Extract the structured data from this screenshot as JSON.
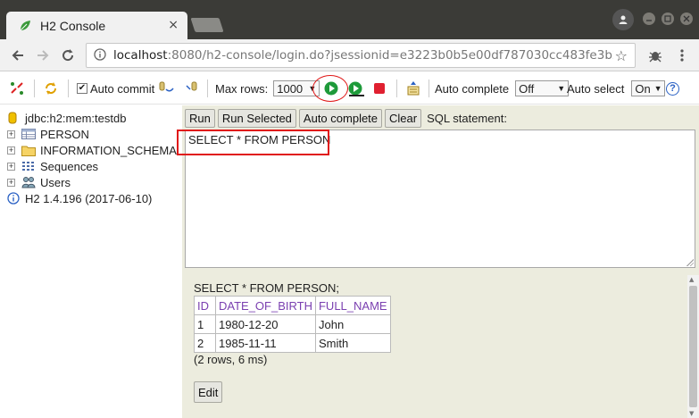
{
  "browser": {
    "tab_title": "H2 Console",
    "tab_close": "×",
    "url_host": "localhost",
    "url_rest": ":8080/h2-console/login.do?jsessionid=e3223b0b5e00df787030cc483fe3b28f"
  },
  "toolbar": {
    "auto_commit_label": "Auto commit",
    "auto_commit_checked": true,
    "max_rows_label": "Max rows:",
    "max_rows_value": "1000",
    "auto_complete_label": "Auto complete",
    "auto_complete_value": "Off",
    "auto_select_label": "Auto select",
    "auto_select_value": "On",
    "help_label": "?"
  },
  "tree": {
    "connection": "jdbc:h2:mem:testdb",
    "items": [
      {
        "label": "PERSON",
        "icon": "table-icon"
      },
      {
        "label": "INFORMATION_SCHEMA",
        "icon": "folder-icon"
      },
      {
        "label": "Sequences",
        "icon": "sequences-icon"
      },
      {
        "label": "Users",
        "icon": "users-icon"
      }
    ],
    "version": "H2 1.4.196 (2017-06-10)"
  },
  "sql_panel": {
    "buttons": {
      "run": "Run",
      "run_selected": "Run Selected",
      "auto_complete": "Auto complete",
      "clear": "Clear"
    },
    "statement_label": "SQL statement:",
    "editor_text": "SELECT * FROM PERSON"
  },
  "results": {
    "statement": "SELECT * FROM PERSON;",
    "columns": [
      "ID",
      "DATE_OF_BIRTH",
      "FULL_NAME"
    ],
    "rows": [
      [
        "1",
        "1980-12-20",
        "John"
      ],
      [
        "2",
        "1985-11-11",
        "Smith"
      ]
    ],
    "summary": "(2 rows, 6 ms)",
    "edit_button": "Edit"
  },
  "colors": {
    "accent_highlight": "#e01818",
    "result_header": "#7a3fb0",
    "pane_bg": "#ececde"
  }
}
